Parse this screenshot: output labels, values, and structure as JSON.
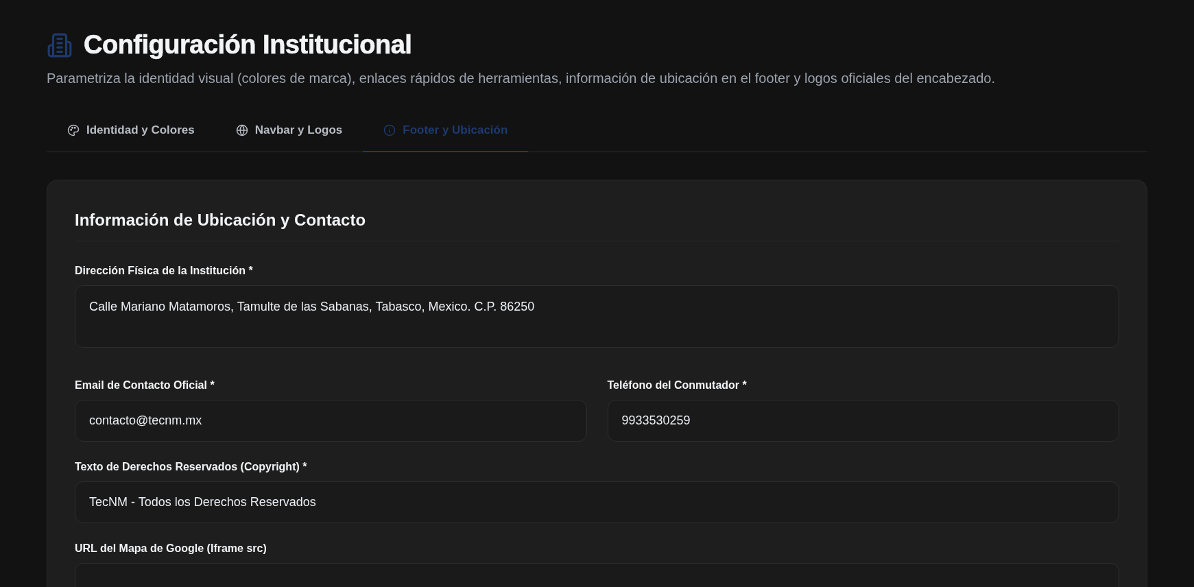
{
  "header": {
    "title": "Configuración Institucional",
    "subtitle": "Parametriza la identidad visual (colores de marca), enlaces rápidos de herramientas, información de ubicación en el footer y logos oficiales del encabezado."
  },
  "tabs": [
    {
      "label": "Identidad y Colores",
      "selected": false
    },
    {
      "label": "Navbar y Logos",
      "selected": false
    },
    {
      "label": "Footer y Ubicación",
      "selected": true
    }
  ],
  "card": {
    "title": "Información de Ubicación y Contacto",
    "rows": [
      [
        {
          "kind": "textarea",
          "label": "Dirección Física de la Institución *",
          "value": "Calle Mariano Matamoros, Tamulte de las Sabanas, Tabasco, Mexico. C.P. 86250"
        }
      ],
      [
        {
          "kind": "input",
          "label": "Email de Contacto Oficial *",
          "value": "contacto@tecnm.mx"
        },
        {
          "kind": "input",
          "label": "Teléfono del Conmutador *",
          "value": "9933530259"
        }
      ],
      [
        {
          "kind": "input",
          "label": "Texto de Derechos Reservados (Copyright) *",
          "value": "TecNM - Todos los Derechos Reservados"
        }
      ],
      [
        {
          "kind": "input",
          "label": "URL del Mapa de Google (Iframe src)"
        }
      ]
    ]
  }
}
